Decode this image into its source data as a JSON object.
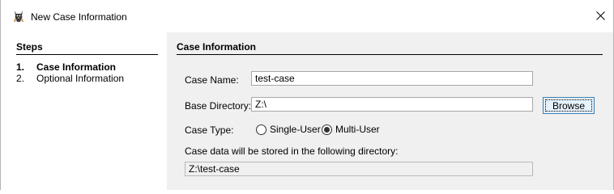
{
  "window": {
    "title": "New Case Information",
    "close_symbol": "✕"
  },
  "steps": {
    "header": "Steps",
    "items": [
      {
        "number": "1.",
        "label": "Case Information",
        "active": true
      },
      {
        "number": "2.",
        "label": "Optional Information",
        "active": false
      }
    ]
  },
  "case_info": {
    "header": "Case Information",
    "case_name_label": "Case Name:",
    "case_name_value": "test-case",
    "base_dir_label": "Base Directory:",
    "base_dir_value": "Z:\\",
    "browse_label": "Browse",
    "case_type_label": "Case Type:",
    "case_type_options": [
      {
        "label": "Single-User",
        "selected": false
      },
      {
        "label": "Multi-User",
        "selected": true
      }
    ],
    "storage_note": "Case data will be stored in the following directory:",
    "storage_path": "Z:\\test-case"
  },
  "icons": {
    "app_icon": "autopsy-dog-icon",
    "close_icon": "close-icon"
  },
  "colors": {
    "panel_background": "#f0f0f0",
    "button_border": "#3c7fb1",
    "button_background": "#e5f1fb"
  }
}
